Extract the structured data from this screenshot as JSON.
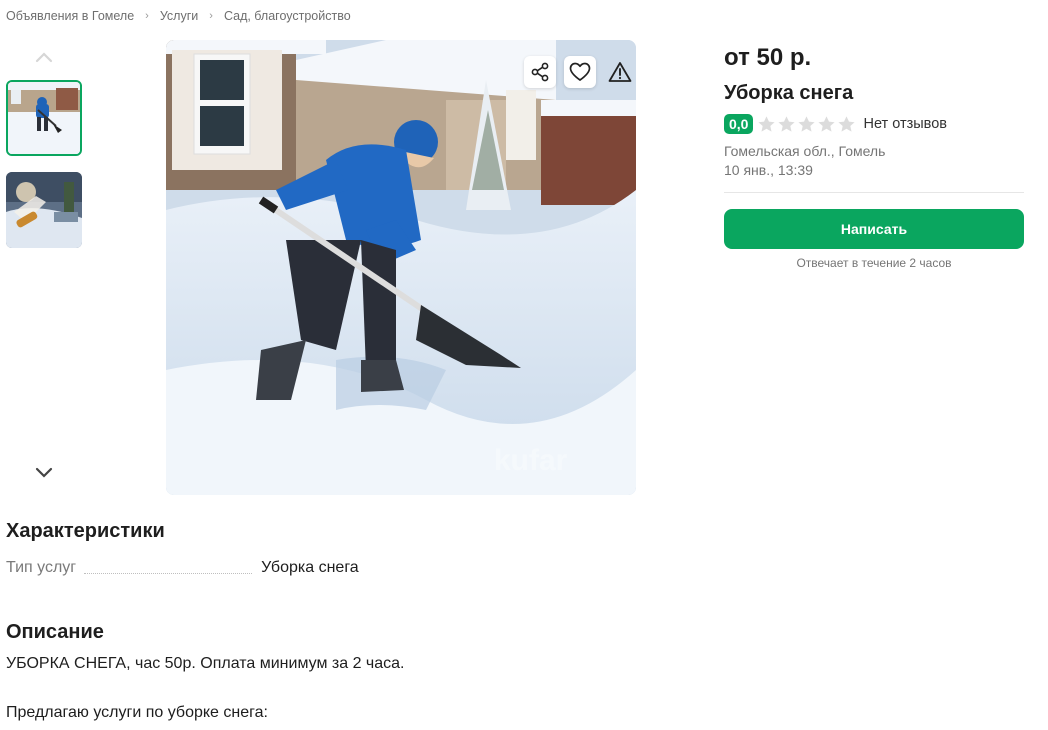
{
  "breadcrumb": {
    "items": [
      "Объявления в Гомеле",
      "Услуги",
      "Сад, благоустройство"
    ]
  },
  "gallery": {
    "thumbnails": [
      "snow-shoveling-photo-1",
      "snow-blowing-photo-2"
    ],
    "selected_index": 0,
    "main_image": "man-in-blue-jacket-shoveling-snow"
  },
  "photo_actions": {
    "icons": [
      "share-icon",
      "heart-icon",
      "warning-icon"
    ]
  },
  "listing": {
    "price": "от 50 р.",
    "title": "Уборка снега",
    "rating_value": "0,0",
    "rating_stars": 0,
    "reviews_text": "Нет отзывов",
    "location": "Гомельская обл., Гомель",
    "date": "10 янв., 13:39",
    "write_button": "Написать",
    "reply_note": "Отвечает в течение 2 часов"
  },
  "specs": {
    "heading": "Характеристики",
    "rows": [
      {
        "key": "Тип услуг",
        "value": "Уборка снега"
      }
    ]
  },
  "description": {
    "heading": "Описание",
    "line1": "УБОРКА СНЕГА, час 50р. Оплата минимум за 2 часа.",
    "line2": "Предлагаю услуги по уборке снега:"
  },
  "colors": {
    "accent_green": "#0aa65f",
    "text_dark": "#1e1e1e",
    "text_muted": "#757575"
  }
}
